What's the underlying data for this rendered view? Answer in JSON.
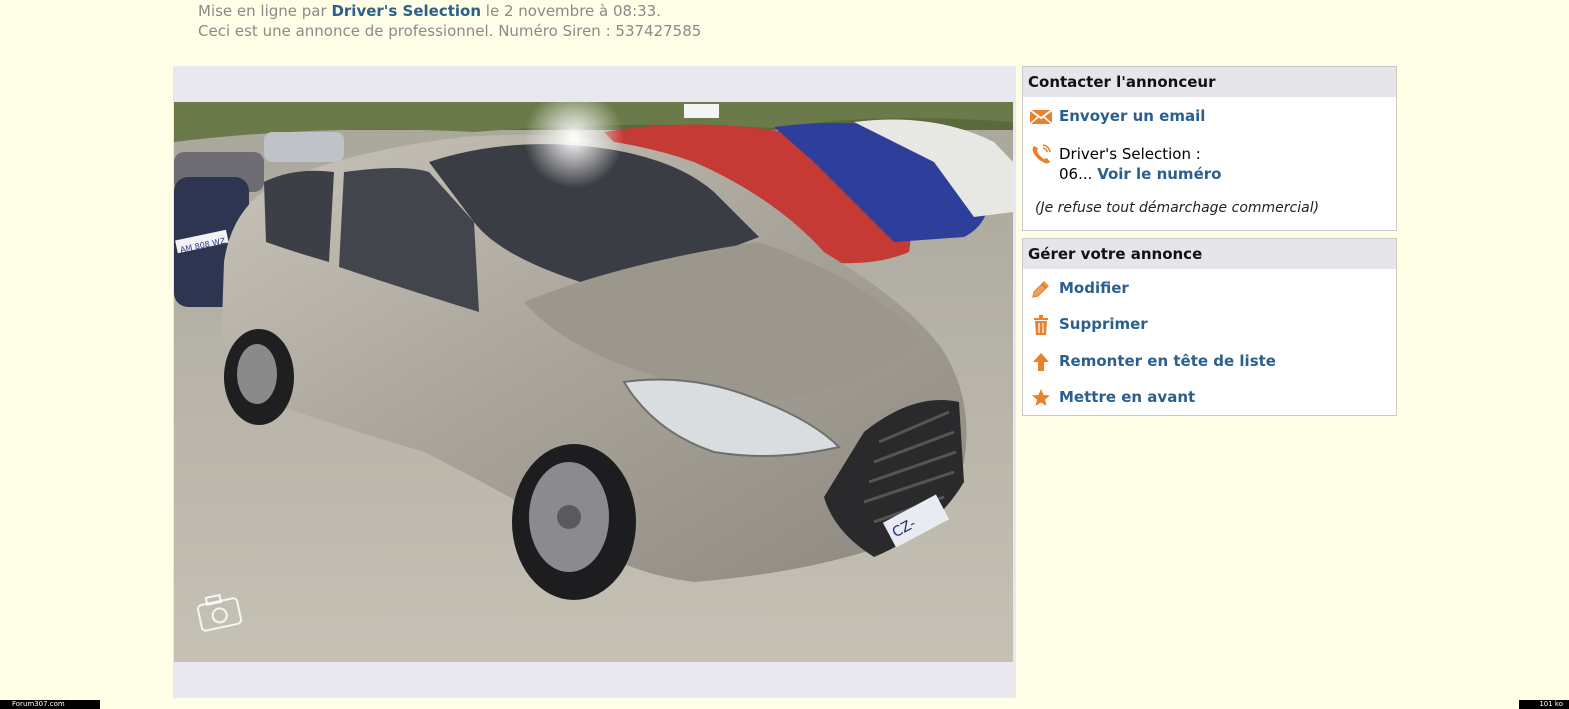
{
  "meta": {
    "prefix": "Mise en ligne par",
    "seller": "Driver's Selection",
    "suffix": "le 2 novembre à 08:33.",
    "pro_notice": "Ceci est une annonce de professionnel. Numéro Siren : 537427585"
  },
  "contact": {
    "title": "Contacter l'annonceur",
    "email_label": "Envoyer un email",
    "phone_name": "Driver's Selection :",
    "phone_prefix": "06...",
    "phone_link": "Voir le numéro",
    "notice": "(Je refuse tout démarchage commercial)"
  },
  "manage": {
    "title": "Gérer votre annonce",
    "items": [
      {
        "label": "Modifier",
        "icon": "pencil-icon"
      },
      {
        "label": "Supprimer",
        "icon": "trash-icon"
      },
      {
        "label": "Remonter en tête de liste",
        "icon": "arrow-up-icon"
      },
      {
        "label": "Mettre en avant",
        "icon": "star-icon"
      }
    ]
  },
  "photo": {
    "plate_left": "AM 808 WZ",
    "plate_front": "CZ-"
  },
  "footer": {
    "left": "Forum307.com",
    "right": "101 ko"
  },
  "colors": {
    "background": "#ffffe8",
    "link": "#2b5f8e",
    "icon_orange": "#e8822a",
    "panel_header": "#e6e6ea"
  }
}
